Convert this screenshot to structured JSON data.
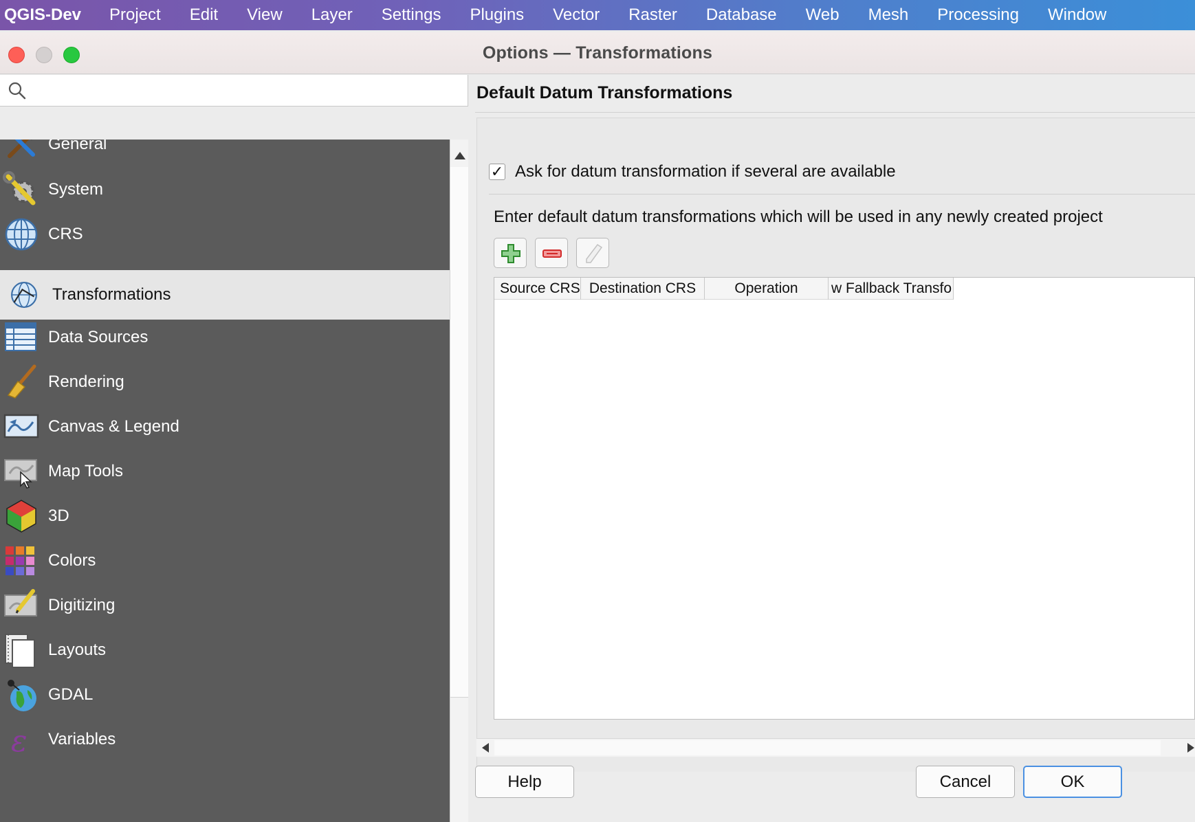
{
  "menubar": {
    "app": "QGIS-Dev",
    "items": [
      "Project",
      "Edit",
      "View",
      "Layer",
      "Settings",
      "Plugins",
      "Vector",
      "Raster",
      "Database",
      "Web",
      "Mesh",
      "Processing",
      "Window"
    ]
  },
  "window": {
    "title": "Options — Transformations"
  },
  "search": {
    "value": "",
    "placeholder": ""
  },
  "nav": {
    "items": [
      {
        "label": "General",
        "icon": "hammer-wrench-icon"
      },
      {
        "label": "System",
        "icon": "gear-wrench-icon"
      },
      {
        "label": "CRS",
        "icon": "globe-grid-icon"
      },
      {
        "label": "Transformations",
        "icon": "globe-transform-icon",
        "active": true
      },
      {
        "label": "Data Sources",
        "icon": "table-icon"
      },
      {
        "label": "Rendering",
        "icon": "paint-brush-icon"
      },
      {
        "label": "Canvas & Legend",
        "icon": "map-canvas-icon"
      },
      {
        "label": "Map Tools",
        "icon": "map-cursor-icon"
      },
      {
        "label": "3D",
        "icon": "cube-icon"
      },
      {
        "label": "Colors",
        "icon": "color-swatches-icon"
      },
      {
        "label": "Digitizing",
        "icon": "map-pencil-icon"
      },
      {
        "label": "Layouts",
        "icon": "layout-pages-icon"
      },
      {
        "label": "GDAL",
        "icon": "gdal-globe-icon"
      },
      {
        "label": "Variables",
        "icon": "epsilon-icon"
      }
    ]
  },
  "panel": {
    "section_title": "Default Datum Transformations",
    "ask_checkbox": {
      "label": "Ask for datum transformation if several are available",
      "checked": true,
      "mark": "✓"
    },
    "description": "Enter default datum transformations which will be used in any newly created project",
    "toolbar": {
      "add": "plus-icon",
      "remove": "minus-icon",
      "edit": "pencil-icon"
    },
    "table": {
      "columns": [
        "Source CRS",
        "Destination CRS",
        "Operation",
        "w Fallback Transfo"
      ]
    }
  },
  "buttons": {
    "help": "Help",
    "cancel": "Cancel",
    "ok": "OK"
  },
  "colors": {
    "accent": "#4a90e2",
    "sidebar": "#5b5b5b",
    "active_row": "#e6e6e6"
  }
}
